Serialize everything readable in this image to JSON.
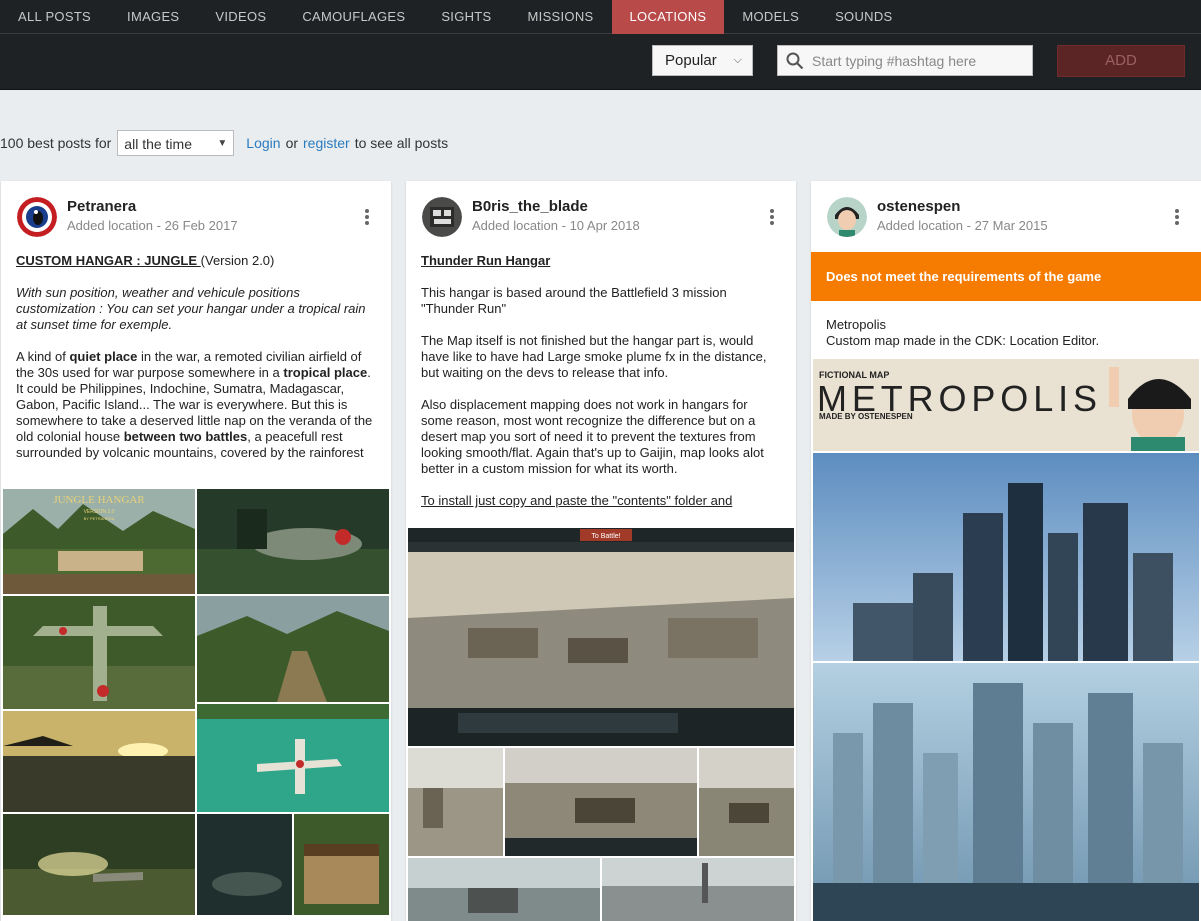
{
  "nav": {
    "tabs": [
      "ALL POSTS",
      "IMAGES",
      "VIDEOS",
      "CAMOUFLAGES",
      "SIGHTS",
      "MISSIONS",
      "LOCATIONS",
      "MODELS",
      "SOUNDS"
    ],
    "active_tab": "LOCATIONS",
    "sort_value": "Popular",
    "search_placeholder": "Start typing #hashtag here",
    "add_label": "ADD"
  },
  "filter": {
    "prefix": "100 best posts for",
    "period": "all the time",
    "login": "Login",
    "or": "or",
    "register": "register",
    "suffix": "to see all posts"
  },
  "posts": [
    {
      "author": "Petranera",
      "subtitle": "Added location - 26 Feb 2017",
      "title": "CUSTOM HANGAR : JUNGLE ",
      "title_suffix": "(Version 2.0)",
      "italic": "With sun position, weather and vehicule positions customization : You can set your hangar under a tropical rain at sunset time for exemple.",
      "p1_a": "A kind of ",
      "p1_b": "quiet place",
      "p1_c": " in the war, a remoted civilian airfield of the 30s used for war purpose somewhere in a ",
      "p1_d": "tropical place",
      "p1_e": ". It could be Philippines, Indochine, Sumatra, Madagascar, Gabon, Pacific Island... The war is everywhere. But this is somewhere to take a deserved little nap on the veranda of the old colonial house ",
      "p1_f": "between two battles",
      "p1_g": ", a peacefull rest surrounded by volcanic mountains, covered by the rainforest",
      "image_title": "JUNGLE HANGAR",
      "image_version": "VERSION 2.0",
      "image_by": "BY PETRANERA"
    },
    {
      "author": "B0ris_the_blade",
      "subtitle": "Added location - 10 Apr 2018",
      "title": "Thunder Run Hangar",
      "p1": "This hangar is based around the Battlefield 3 mission \"Thunder Run\"",
      "p2": "The Map itself is not finished but the hangar part is, would have like to have had Large smoke plume fx in the distance, but waiting on the devs to release that info.",
      "p3": "Also displacement mapping does not work in hangars for some reason, most wont recognize the difference but on a desert map you sort of need it to prevent the textures from looking smooth/flat. Again that's up to Gaijin, map looks alot better in a custom mission for what its worth.",
      "p4": "To install just copy and paste the \"contents\" folder and",
      "screen_button": "To Battle!"
    },
    {
      "author": "ostenespen",
      "subtitle": "Added location - 27 Mar 2015",
      "warning": "Does not meet the requirements of the game",
      "p1": "Metropolis",
      "p2": "Custom map made in the CDK: Location Editor.",
      "banner_small": "FICTIONAL MAP",
      "banner_big": "METROPOLIS",
      "banner_by": "MADE BY OSTENESPEN"
    }
  ]
}
